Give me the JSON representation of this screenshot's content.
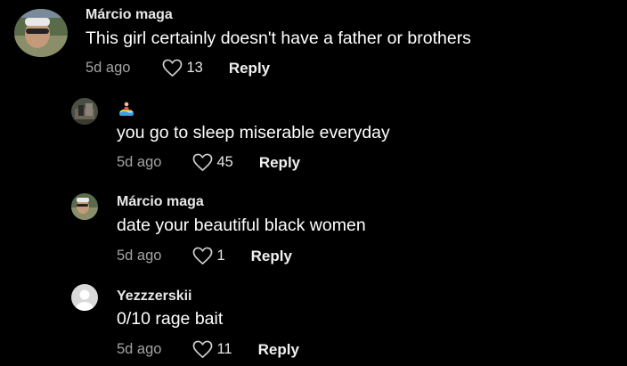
{
  "comments": [
    {
      "username": "Márcio maga",
      "text": "This girl certainly doesn't have a father or brothers",
      "date": "5d ago",
      "likes": "13",
      "reply_label": "Reply",
      "avatar": "profile-photo"
    },
    {
      "username": "",
      "username_icon": "surfer-emoji-icon",
      "text": "you go to sleep miserable everyday",
      "date": "5d ago",
      "likes": "45",
      "reply_label": "Reply",
      "avatar": "profile-photo"
    },
    {
      "username": "Márcio maga",
      "text": "date your beautiful black women",
      "date": "5d ago",
      "likes": "1",
      "reply_label": "Reply",
      "avatar": "profile-photo"
    },
    {
      "username": "Yezzzerskii",
      "text": "0/10 rage bait",
      "date": "5d ago",
      "likes": "11",
      "reply_label": "Reply",
      "avatar": "default-avatar"
    }
  ],
  "colors": {
    "background": "#000000",
    "text": "#ffffff",
    "muted": "#a3a3a3"
  }
}
